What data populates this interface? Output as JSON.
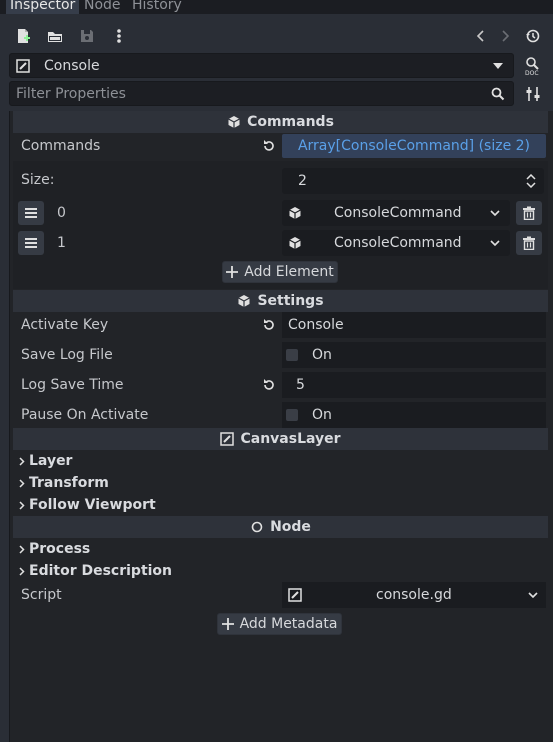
{
  "tabs": [
    {
      "label": "Inspector",
      "active": true
    },
    {
      "label": "Node",
      "active": false
    },
    {
      "label": "History",
      "active": false
    }
  ],
  "toolbar": {
    "icons": [
      "new-resource-icon",
      "open-folder-icon",
      "save-icon",
      "more-vertical-icon",
      "back-icon",
      "forward-icon",
      "history-icon"
    ]
  },
  "object_selector": {
    "value": "Console"
  },
  "filter": {
    "placeholder": "Filter Properties"
  },
  "sections": {
    "commands": {
      "title": "Commands",
      "property_label": "Commands",
      "array_value": "Array[ConsoleCommand] (size 2)",
      "size_label": "Size:",
      "size_value": "2",
      "items": [
        {
          "index": "0",
          "type": "ConsoleCommand"
        },
        {
          "index": "1",
          "type": "ConsoleCommand"
        }
      ],
      "add_button": "Add Element"
    },
    "settings": {
      "title": "Settings",
      "activate_key_label": "Activate Key",
      "activate_key_value": "Console",
      "save_log_label": "Save Log File",
      "save_log_value": "On",
      "log_time_label": "Log Save Time",
      "log_time_value": "5",
      "pause_label": "Pause On Activate",
      "pause_value": "On"
    },
    "canvas_layer": {
      "title": "CanvasLayer",
      "groups": [
        "Layer",
        "Transform",
        "Follow Viewport"
      ]
    },
    "node": {
      "title": "Node",
      "groups": [
        "Process",
        "Editor Description"
      ],
      "script_label": "Script",
      "script_value": "console.gd",
      "add_button": "Add Metadata"
    }
  },
  "colors": {
    "accent": "#70bafa",
    "array_link": "#5aa0e8",
    "background": "#2a2e36",
    "inspector_bg": "#222428"
  }
}
